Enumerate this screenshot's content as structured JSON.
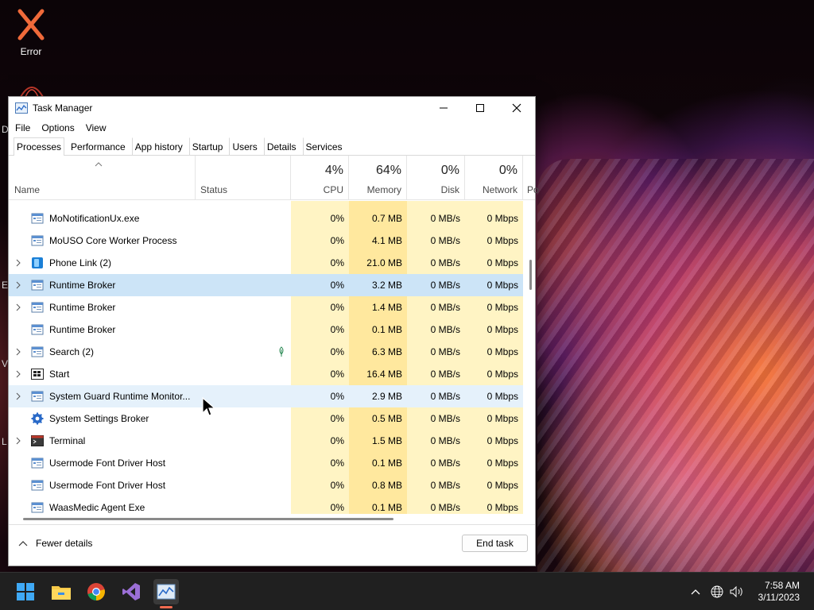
{
  "desktop": {
    "error_icon_label": "Error",
    "partial_labels": [
      "D",
      "E",
      "V",
      "L"
    ]
  },
  "window": {
    "title": "Task Manager",
    "menu": [
      "File",
      "Options",
      "View"
    ],
    "tabs": [
      "Processes",
      "Performance",
      "App history",
      "Startup",
      "Users",
      "Details",
      "Services"
    ],
    "active_tab": "Processes"
  },
  "columns": {
    "name": "Name",
    "status": "Status",
    "cpu": {
      "pct": "4%",
      "label": "CPU"
    },
    "memory": {
      "pct": "64%",
      "label": "Memory"
    },
    "disk": {
      "pct": "0%",
      "label": "Disk"
    },
    "network": {
      "pct": "0%",
      "label": "Network"
    },
    "power": {
      "label": "Po"
    }
  },
  "processes": [
    {
      "name": "MoNotificationUx.exe",
      "cpu": "0%",
      "memory": "0.7 MB",
      "disk": "0 MB/s",
      "network": "0 Mbps",
      "expandable": false,
      "icon": "app-window-icon"
    },
    {
      "name": "MoUSO Core Worker Process",
      "cpu": "0%",
      "memory": "4.1 MB",
      "disk": "0 MB/s",
      "network": "0 Mbps",
      "expandable": false,
      "icon": "app-window-icon"
    },
    {
      "name": "Phone Link (2)",
      "cpu": "0%",
      "memory": "21.0 MB",
      "disk": "0 MB/s",
      "network": "0 Mbps",
      "expandable": true,
      "icon": "phone-link-icon"
    },
    {
      "name": "Runtime Broker",
      "cpu": "0%",
      "memory": "3.2 MB",
      "disk": "0 MB/s",
      "network": "0 Mbps",
      "expandable": true,
      "icon": "app-window-icon",
      "highlight": "selected"
    },
    {
      "name": "Runtime Broker",
      "cpu": "0%",
      "memory": "1.4 MB",
      "disk": "0 MB/s",
      "network": "0 Mbps",
      "expandable": true,
      "icon": "app-window-icon"
    },
    {
      "name": "Runtime Broker",
      "cpu": "0%",
      "memory": "0.1 MB",
      "disk": "0 MB/s",
      "network": "0 Mbps",
      "expandable": false,
      "icon": "app-window-icon"
    },
    {
      "name": "Search (2)",
      "cpu": "0%",
      "memory": "6.3 MB",
      "disk": "0 MB/s",
      "network": "0 Mbps",
      "expandable": true,
      "icon": "app-window-icon",
      "status_leaf": true
    },
    {
      "name": "Start",
      "cpu": "0%",
      "memory": "16.4 MB",
      "disk": "0 MB/s",
      "network": "0 Mbps",
      "expandable": true,
      "icon": "start-icon"
    },
    {
      "name": "System Guard Runtime Monitor...",
      "cpu": "0%",
      "memory": "2.9 MB",
      "disk": "0 MB/s",
      "network": "0 Mbps",
      "expandable": true,
      "icon": "app-window-icon",
      "highlight": "hover"
    },
    {
      "name": "System Settings Broker",
      "cpu": "0%",
      "memory": "0.5 MB",
      "disk": "0 MB/s",
      "network": "0 Mbps",
      "expandable": false,
      "icon": "gear-icon"
    },
    {
      "name": "Terminal",
      "cpu": "0%",
      "memory": "1.5 MB",
      "disk": "0 MB/s",
      "network": "0 Mbps",
      "expandable": true,
      "icon": "terminal-icon"
    },
    {
      "name": "Usermode Font Driver Host",
      "cpu": "0%",
      "memory": "0.1 MB",
      "disk": "0 MB/s",
      "network": "0 Mbps",
      "expandable": false,
      "icon": "app-window-icon"
    },
    {
      "name": "Usermode Font Driver Host",
      "cpu": "0%",
      "memory": "0.8 MB",
      "disk": "0 MB/s",
      "network": "0 Mbps",
      "expandable": false,
      "icon": "app-window-icon"
    },
    {
      "name": "WaasMedic Agent Exe",
      "cpu": "0%",
      "memory": "0.1 MB",
      "disk": "0 MB/s",
      "network": "0 Mbps",
      "expandable": false,
      "icon": "app-window-icon"
    }
  ],
  "footer": {
    "fewer_details": "Fewer details",
    "end_task": "End task"
  },
  "taskbar": {
    "apps": [
      "start-icon",
      "file-explorer-icon",
      "chrome-icon",
      "visual-studio-icon",
      "task-manager-icon"
    ],
    "active_app": "task-manager-icon",
    "clock_time": "7:58 AM",
    "clock_date": "3/11/2023"
  },
  "colors": {
    "cpu_heat": "#fff4c4",
    "memory_heat": "#ffe89e",
    "selected_row": "#cce4f7",
    "hover_row": "#e5f1fb",
    "taskbar": "#202020",
    "active_indicator": "#f06a4f"
  }
}
